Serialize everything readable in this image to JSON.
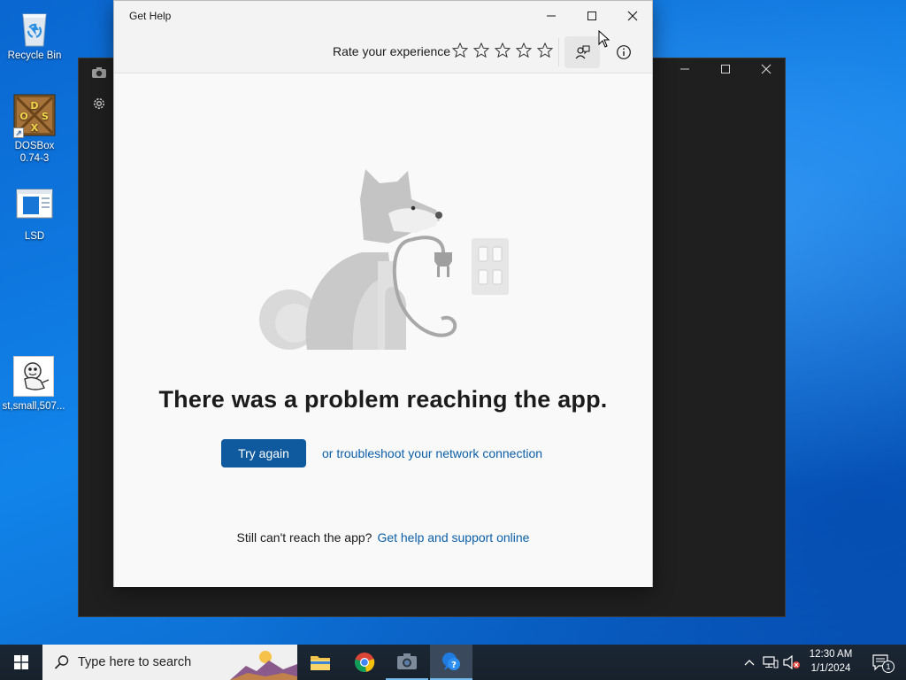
{
  "desktop": {
    "icons": [
      {
        "label": "Recycle Bin"
      },
      {
        "label": "DOSBox 0.74-3"
      },
      {
        "label": "LSD"
      },
      {
        "label": "st,small,507..."
      }
    ]
  },
  "help_window": {
    "title": "Get Help",
    "rate_label": "Rate your experience",
    "headline": "There was a problem reaching the app.",
    "try_again": "Try again",
    "troubleshoot_link": "or troubleshoot your network connection",
    "still_text": "Still can't reach the app?",
    "support_link": "Get help and support online"
  },
  "taskbar": {
    "search_placeholder": "Type here to search",
    "time": "12:30 AM",
    "date": "1/1/2024",
    "notification_count": "1"
  },
  "colors": {
    "accent": "#0f5a9e",
    "link": "#0b5fa8",
    "taskbar": "#1b2734"
  }
}
